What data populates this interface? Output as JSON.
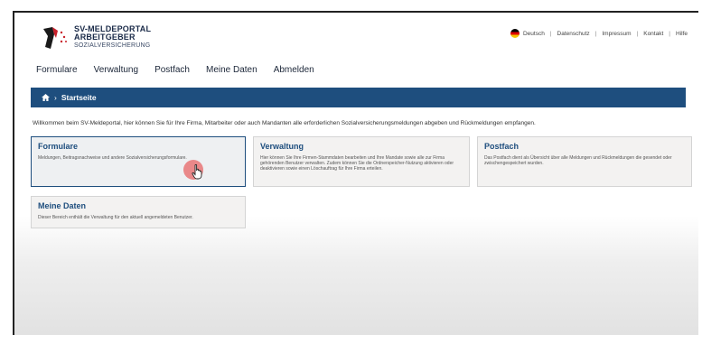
{
  "header": {
    "logo_line1": "SV-MELDEPORTAL",
    "logo_line2": "ARBEITGEBER",
    "logo_line3": "SOZIALVERSICHERUNG"
  },
  "meta_nav": {
    "language": "Deutsch",
    "links": [
      "Datenschutz",
      "Impressum",
      "Kontakt",
      "Hilfe"
    ]
  },
  "main_nav": {
    "items": [
      "Formulare",
      "Verwaltung",
      "Postfach",
      "Meine Daten",
      "Abmelden"
    ]
  },
  "breadcrumb": {
    "current": "Startseite"
  },
  "intro_text": "Willkommen beim SV-Meldeportal, hier können Sie für Ihre Firma, Mitarbeiter oder auch Mandanten alle erforderlichen Sozialversicherungsmeldungen abgeben und Rückmeldungen empfangen.",
  "cards": [
    {
      "title": "Formulare",
      "desc": "Meldungen, Beitragsnachweise und andere Sozialversicherungsformulare."
    },
    {
      "title": "Verwaltung",
      "desc": "Hier können Sie Ihre Firmen-Stammdaten bearbeiten und Ihre Mandate sowie alle zur Firma gehörenden Benutzer verwalten. Zudem können Sie die Ordnerspeicher-Nutzung aktivieren oder deaktivieren sowie einen Löschauftrag für Ihre Firma erteilen."
    },
    {
      "title": "Postfach",
      "desc": "Das Postfach dient als Übersicht über alle Meldungen und Rückmeldungen die gesendet oder zwischengespeichert wurden."
    },
    {
      "title": "Meine Daten",
      "desc": "Dieser Bereich enthält die Verwaltung für den aktuell angemeldeten Benutzer."
    }
  ],
  "colors": {
    "brand_blue": "#1e4e7e",
    "card_bg": "#f3f2f1",
    "click_highlight": "#e75050"
  }
}
